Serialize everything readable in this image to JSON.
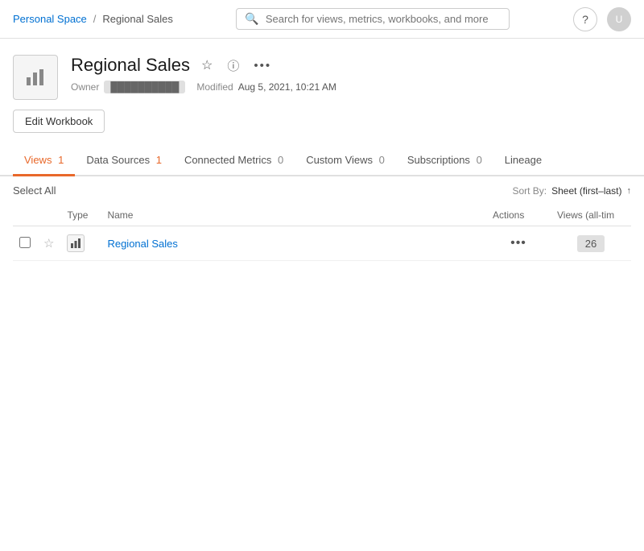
{
  "header": {
    "breadcrumb": {
      "personal": "Personal Space",
      "separator": "/",
      "current": "Regional Sales"
    },
    "search": {
      "placeholder": "Search for views, metrics, workbooks, and more"
    },
    "help_label": "?",
    "avatar_label": "U"
  },
  "workbook": {
    "title": "Regional Sales",
    "owner_label": "Owner",
    "owner_name": "██████████",
    "modified_label": "Modified",
    "modified_date": "Aug 5, 2021, 10:21 AM",
    "edit_btn": "Edit Workbook"
  },
  "tabs": [
    {
      "id": "views",
      "label": "Views",
      "count": "1",
      "count_style": "orange",
      "active": true
    },
    {
      "id": "datasources",
      "label": "Data Sources",
      "count": "1",
      "count_style": "orange",
      "active": false
    },
    {
      "id": "metrics",
      "label": "Connected Metrics",
      "count": "0",
      "count_style": "gray",
      "active": false
    },
    {
      "id": "customviews",
      "label": "Custom Views",
      "count": "0",
      "count_style": "gray",
      "active": false
    },
    {
      "id": "subscriptions",
      "label": "Subscriptions",
      "count": "0",
      "count_style": "gray",
      "active": false
    },
    {
      "id": "lineage",
      "label": "Lineage",
      "count": "",
      "count_style": "gray",
      "active": false
    }
  ],
  "controls": {
    "select_all": "Select All",
    "sort_label": "Sort By:",
    "sort_value": "Sheet (first–last)",
    "sort_arrow": "↑"
  },
  "table": {
    "columns": [
      {
        "id": "checkbox",
        "label": ""
      },
      {
        "id": "star",
        "label": ""
      },
      {
        "id": "type",
        "label": "Type"
      },
      {
        "id": "name",
        "label": "Name"
      },
      {
        "id": "actions",
        "label": "Actions"
      },
      {
        "id": "views",
        "label": "Views (all-tim"
      }
    ],
    "rows": [
      {
        "id": "row-1",
        "name": "Regional Sales",
        "type_icon": "bar-chart",
        "views_count": "26"
      }
    ]
  },
  "icons": {
    "search": "🔍",
    "star_empty": "☆",
    "info": "ⓘ",
    "more": "···",
    "ellipsis": "···",
    "bar_chart": "📊"
  }
}
